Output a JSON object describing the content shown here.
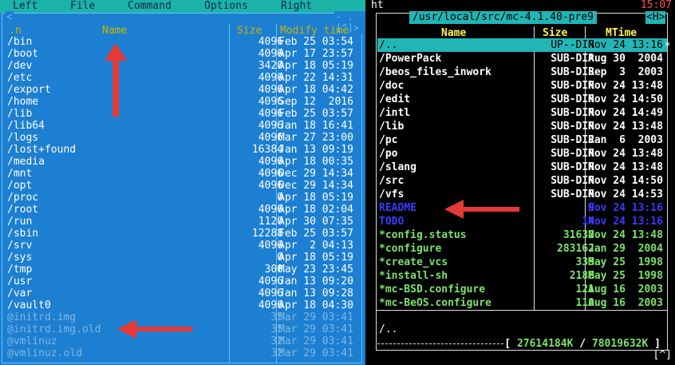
{
  "left_panel": {
    "menu": [
      "Left",
      "File",
      "Command",
      "Options",
      "Right"
    ],
    "frame_left_ctl": "<",
    "frame_right_ctl": "-  .[^]>",
    "columns": {
      "n": ".n",
      "name": "Name",
      "size": "Size",
      "modify": "Modify time"
    },
    "rows": [
      {
        "name": "/bin",
        "size": "4096",
        "mod": "Feb 25 03:54"
      },
      {
        "name": "/boot",
        "size": "4096",
        "mod": "Apr 17 23:57"
      },
      {
        "name": "/dev",
        "size": "3420",
        "mod": "Apr 18 05:19"
      },
      {
        "name": "/etc",
        "size": "4096",
        "mod": "Apr 22 14:31"
      },
      {
        "name": "/export",
        "size": "4096",
        "mod": "Apr 18 04:42"
      },
      {
        "name": "/home",
        "size": "4096",
        "mod": "Sep 12  2016"
      },
      {
        "name": "/lib",
        "size": "4096",
        "mod": "Feb 25 03:57"
      },
      {
        "name": "/lib64",
        "size": "4096",
        "mod": "Jan 18 16:41"
      },
      {
        "name": "/logs",
        "size": "4096",
        "mod": "Mar 27 23:00"
      },
      {
        "name": "/lost+found",
        "size": "16384",
        "mod": "Jan 13 09:19"
      },
      {
        "name": "/media",
        "size": "4096",
        "mod": "Apr 18 00:35"
      },
      {
        "name": "/mnt",
        "size": "4096",
        "mod": "Dec 29 14:34"
      },
      {
        "name": "/opt",
        "size": "4096",
        "mod": "Dec 29 14:34"
      },
      {
        "name": "/proc",
        "size": "0",
        "mod": "Apr 18 05:19"
      },
      {
        "name": "/root",
        "size": "4096",
        "mod": "Apr 18 02:04"
      },
      {
        "name": "/run",
        "size": "1120",
        "mod": "Apr 30 07:35"
      },
      {
        "name": "/sbin",
        "size": "12288",
        "mod": "Feb 25 03:57"
      },
      {
        "name": "/srv",
        "size": "4096",
        "mod": "Apr  2 04:13"
      },
      {
        "name": "/sys",
        "size": "0",
        "mod": "Apr 18 05:19"
      },
      {
        "name": "/tmp",
        "size": "300",
        "mod": "May 23 23:45"
      },
      {
        "name": "/usr",
        "size": "4096",
        "mod": "Jan 13 09:20"
      },
      {
        "name": "/var",
        "size": "4096",
        "mod": "Jan 13 09:28"
      },
      {
        "name": "/vault0",
        "size": "4096",
        "mod": "Apr 18 04:30"
      },
      {
        "name": "@initrd.img",
        "size": "35",
        "mod": "Mar 29 03:41",
        "dim": true
      },
      {
        "name": "@initrd.img.old",
        "size": "35",
        "mod": "Mar 29 03:41",
        "dim": true
      },
      {
        "name": "@vmlinuz",
        "size": "32",
        "mod": "Mar 29 03:41",
        "dim": true
      },
      {
        "name": "@vmlinuz.old",
        "size": "32",
        "mod": "Mar 29 03:41",
        "dim": true
      }
    ]
  },
  "right_panel": {
    "top_command": "ht",
    "clock": "15:07",
    "title": "/usr/local/src/mc-4.1.40-pre9",
    "hint": "<H>",
    "columns": {
      "name": "Name",
      "size": "Size",
      "mtime": "MTime"
    },
    "rows": [
      {
        "name": "/..",
        "size": "UP--DIR",
        "mt": "Nov 24 13:16",
        "style": "sel"
      },
      {
        "name": "/PowerPack",
        "size": "SUB-DIR",
        "mt": "Aug 30  2004",
        "style": "dir"
      },
      {
        "name": "/beos_files_inwork",
        "size": "SUB-DIR",
        "mt": "Sep  3  2003",
        "style": "dir"
      },
      {
        "name": "/doc",
        "size": "SUB-DIR",
        "mt": "Nov 24 13:48",
        "style": "dir"
      },
      {
        "name": "/edit",
        "size": "SUB-DIR",
        "mt": "Nov 24 14:50",
        "style": "dir"
      },
      {
        "name": "/intl",
        "size": "SUB-DIR",
        "mt": "Nov 24 14:49",
        "style": "dir"
      },
      {
        "name": "/lib",
        "size": "SUB-DIR",
        "mt": "Nov 24 13:48",
        "style": "dir"
      },
      {
        "name": "/pc",
        "size": "SUB-DIR",
        "mt": "Jan  6  2003",
        "style": "dir"
      },
      {
        "name": "/po",
        "size": "SUB-DIR",
        "mt": "Nov 24 13:48",
        "style": "dir"
      },
      {
        "name": "/slang",
        "size": "SUB-DIR",
        "mt": "Nov 24 13:48",
        "style": "dir"
      },
      {
        "name": "/src",
        "size": "SUB-DIR",
        "mt": "Nov 24 14:50",
        "style": "dir"
      },
      {
        "name": "/vfs",
        "size": "SUB-DIR",
        "mt": "Nov 24 14:53",
        "style": "dir"
      },
      {
        "name": "README",
        "size": "9",
        "mt": "Nov 24 13:16",
        "style": "c-blue"
      },
      {
        "name": "TODO",
        "size": "14",
        "mt": "Nov 24 13:16",
        "style": "c-blue"
      },
      {
        "name": "*config.status",
        "size": "31632",
        "mt": "Nov 24 13:48",
        "style": "c-green"
      },
      {
        "name": "*configure",
        "size": "283162",
        "mt": "Jan 29  2004",
        "style": "c-green"
      },
      {
        "name": "*create_vcs",
        "size": "339",
        "mt": "May 25  1998",
        "style": "c-green"
      },
      {
        "name": "*install-sh",
        "size": "2186",
        "mt": "May 25  1998",
        "style": "c-green"
      },
      {
        "name": "*mc-BSD.configure",
        "size": "121",
        "mt": "Aug 16  2003",
        "style": "c-green"
      },
      {
        "name": "*mc-BeOS.configure",
        "size": "110",
        "mt": "Aug 16  2003",
        "style": "c-green"
      }
    ],
    "footer_path": "/..",
    "free_used": "27614184K",
    "free_sep": " / ",
    "free_total": "78019632K",
    "free_open": "[ ",
    "free_close": " ]",
    "corner": "[^]",
    "marker": "*"
  }
}
